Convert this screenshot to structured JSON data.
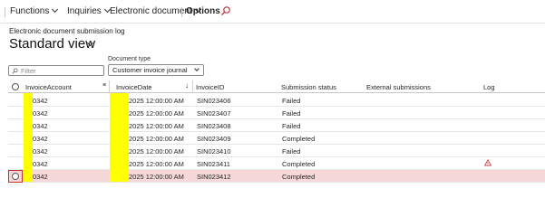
{
  "toolbar": {
    "functions": "Functions",
    "inquiries": "Inquiries",
    "electronic_document": "Electronic document",
    "options": "Options"
  },
  "breadcrumb": "Electronic document submission log",
  "title": "Standard view",
  "filter": {
    "placeholder": "Filter"
  },
  "document_type": {
    "label": "Document type",
    "value": "Customer invoice journal"
  },
  "grid": {
    "columns": [
      "InvoiceAccount",
      "InvoiceDate",
      "InvoiceID",
      "Submission status",
      "External submissions",
      "Log"
    ],
    "rows": [
      {
        "account": "0342",
        "date": "2025 12:00:00 AM",
        "id": "SIN023406",
        "status": "Failed",
        "log_warning": false
      },
      {
        "account": "0342",
        "date": "2025 12:00:00 AM",
        "id": "SIN023407",
        "status": "Failed",
        "log_warning": false
      },
      {
        "account": "0342",
        "date": "2025 12:00:00 AM",
        "id": "SIN023408",
        "status": "Failed",
        "log_warning": false
      },
      {
        "account": "0342",
        "date": "2025 12:00:00 AM",
        "id": "SIN023409",
        "status": "Completed",
        "log_warning": false
      },
      {
        "account": "0342",
        "date": "2025 12:00:00 AM",
        "id": "SIN023410",
        "status": "Failed",
        "log_warning": false
      },
      {
        "account": "0342",
        "date": "2025 12:00:00 AM",
        "id": "SIN023411",
        "status": "Completed",
        "log_warning": true
      },
      {
        "account": "0342",
        "date": "2025 12:00:00 AM",
        "id": "SIN023412",
        "status": "Completed",
        "log_warning": false
      }
    ]
  },
  "colors": {
    "selected_row": "#f6d8d8",
    "warning": "#d13438",
    "redaction": "#ffff00"
  }
}
